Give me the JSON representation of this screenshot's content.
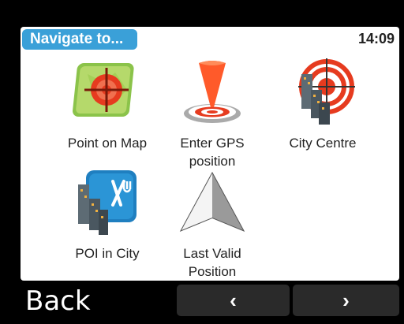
{
  "header": {
    "title": "Navigate to...",
    "time": "14:09"
  },
  "tiles": [
    {
      "label": "Point on Map",
      "icon": "map-crosshair-icon"
    },
    {
      "label": "Enter GPS\nposition",
      "icon": "gps-pin-icon"
    },
    {
      "label": "City Centre",
      "icon": "city-centre-icon"
    },
    {
      "label": "POI in City",
      "icon": "poi-city-icon"
    },
    {
      "label": "Last Valid\nPosition",
      "icon": "last-position-icon"
    }
  ],
  "footer": {
    "back_label": "Back",
    "prev_label": "‹",
    "next_label": "›"
  },
  "colors": {
    "accent": "#3aa0d8",
    "target_red": "#e63b1f"
  }
}
